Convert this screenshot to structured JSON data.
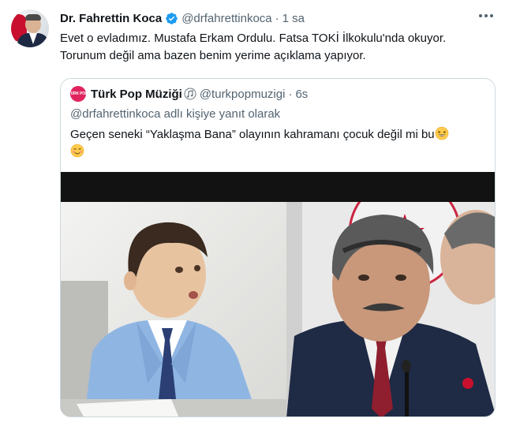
{
  "tweet": {
    "display_name": "Dr. Fahrettin Koca",
    "handle": "@drfahrettinkoca",
    "dot": "·",
    "time": "1 sa",
    "text_line1": "Evet o evladımız. Mustafa Erkam Ordulu. Fatsa TOKİ İlkokulu'nda okuyor.",
    "text_line2": "Torunum değil ama bazen benim yerime açıklama yapıyor."
  },
  "quoted": {
    "display_name": "Türk Pop Müziği",
    "handle": "@turkpopmuzigi",
    "dot": "·",
    "time": "6s",
    "reply_note": "@drfahrettinkoca adlı kişiye yanıt olarak",
    "text_line1": "Geçen seneki “Yaklaşma Bana” olayının kahramanı çocuk değil mi bu",
    "avatar_text": "TÜRK POP"
  },
  "colors": {
    "verified": "#1d9bf0",
    "secondary_text": "#536471",
    "border": "#cfd9de",
    "brand_red": "#e0245e"
  },
  "icons": {
    "verified": "verified-badge-icon",
    "more": "more-dots-icon",
    "music": "music-note-icon",
    "emoji": "grinning-squinting-face-icon"
  }
}
